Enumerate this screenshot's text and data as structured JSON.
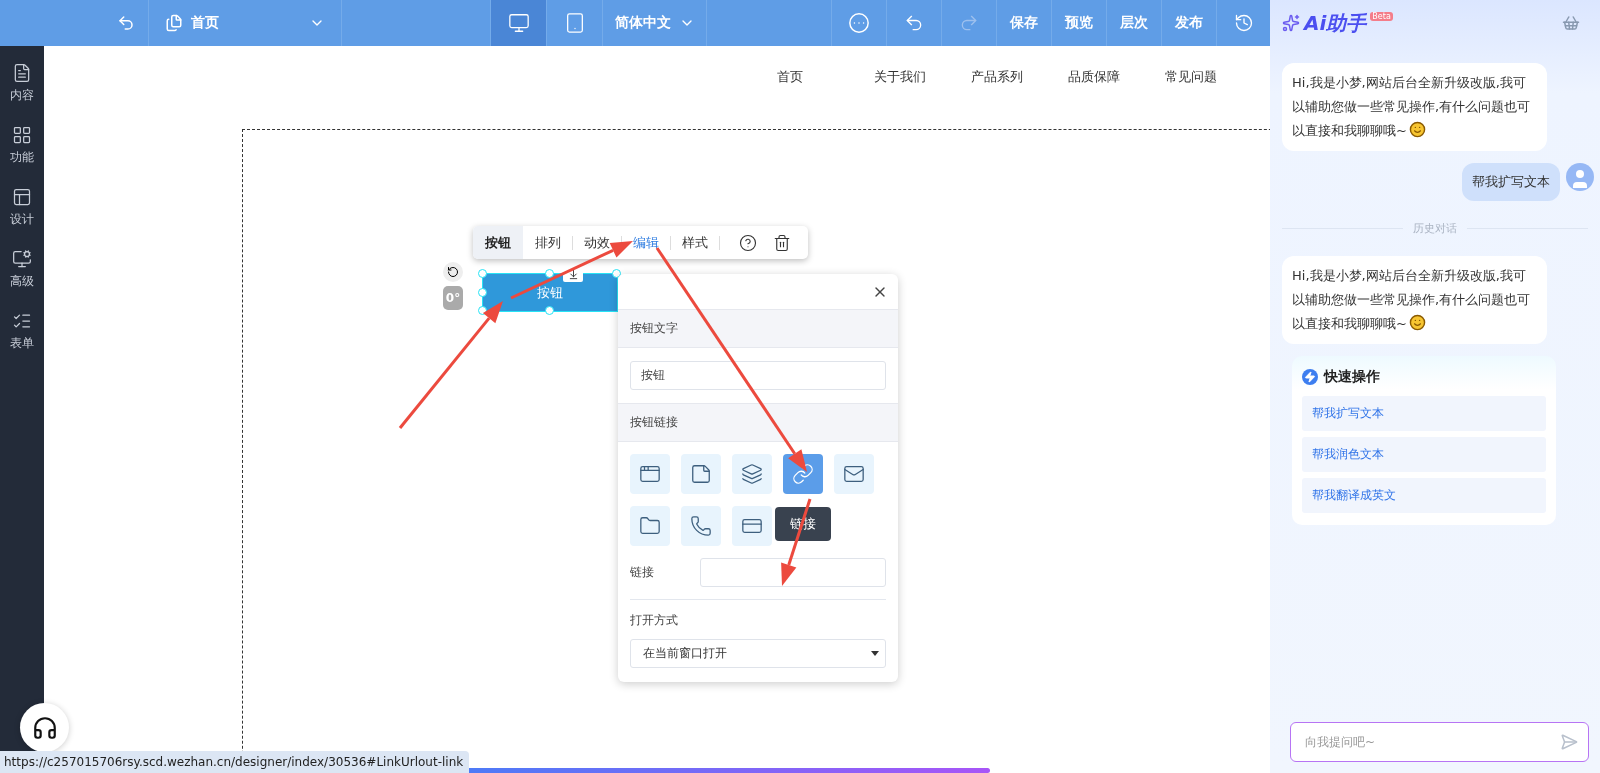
{
  "topbar": {
    "back": {
      "disabled": false
    },
    "page_select": {
      "label": "首页"
    },
    "devices": [
      {
        "kind": "desktop",
        "selected": true
      },
      {
        "kind": "mobile",
        "selected": false
      }
    ],
    "language": {
      "label": "简体中文"
    },
    "actions": [
      {
        "kind": "more",
        "disabled": false
      },
      {
        "kind": "undo",
        "disabled": false
      },
      {
        "kind": "redo",
        "disabled": true
      },
      {
        "kind": "text",
        "label": "保存",
        "disabled": false
      },
      {
        "kind": "text",
        "label": "预览",
        "disabled": false
      },
      {
        "kind": "text",
        "label": "层次",
        "disabled": false
      },
      {
        "kind": "text",
        "label": "发布",
        "disabled": false
      },
      {
        "kind": "history",
        "disabled": false
      }
    ]
  },
  "sidebar": {
    "items": [
      {
        "kind": "content",
        "label": "内容"
      },
      {
        "kind": "features",
        "label": "功能"
      },
      {
        "kind": "design",
        "label": "设计"
      },
      {
        "kind": "advanced",
        "label": "高级"
      },
      {
        "kind": "form",
        "label": "表单"
      }
    ]
  },
  "canvas": {
    "nav_menu": [
      "首页",
      "关于我们",
      "产品系列",
      "品质保障",
      "常见问题"
    ],
    "rotation": "0°",
    "element_button": "按钮",
    "toolbar": {
      "title": "按钮",
      "tabs": [
        {
          "label": "排列",
          "selected": false
        },
        {
          "label": "动效",
          "selected": false
        },
        {
          "label": "编辑",
          "selected": true
        },
        {
          "label": "样式",
          "selected": false
        }
      ]
    },
    "panel": {
      "text_section": "按钮文字",
      "text_value": "按钮",
      "link_section": "按钮链接",
      "link_types": [
        {
          "kind": "page",
          "selected": false
        },
        {
          "kind": "article",
          "selected": false
        },
        {
          "kind": "layers",
          "selected": false
        },
        {
          "kind": "url",
          "selected": true
        },
        {
          "kind": "mail",
          "selected": false
        },
        {
          "kind": "file",
          "selected": false
        },
        {
          "kind": "phone",
          "selected": false
        },
        {
          "kind": "popup",
          "selected": false
        }
      ],
      "tooltip": "链接",
      "link_label": "链接",
      "open_label": "打开方式",
      "open_value": "在当前窗口打开"
    }
  },
  "ai": {
    "title": "Ai助手",
    "badge": "Beta",
    "messages": [
      {
        "kind": "assistant",
        "text": "Hi,我是小梦,网站后台全新升级改版,我可以辅助您做一些常见操作,有什么问题也可以直接和我聊聊哦~"
      },
      {
        "kind": "user",
        "text": "帮我扩写文本"
      },
      {
        "kind": "divider",
        "text": "历史对话"
      },
      {
        "kind": "assistant",
        "text": "Hi,我是小梦,网站后台全新升级改版,我可以辅助您做一些常见操作,有什么问题也可以直接和我聊聊哦~"
      }
    ],
    "quick_actions": {
      "title": "快速操作",
      "items": [
        "帮我扩写文本",
        "帮我润色文本",
        "帮我翻译成英文"
      ]
    },
    "input": {
      "placeholder": "向我提问吧~"
    }
  },
  "status_url": "https://c257015706rsy.scd.wezhan.cn/designer/index/30536#LinkUrlout-link"
}
